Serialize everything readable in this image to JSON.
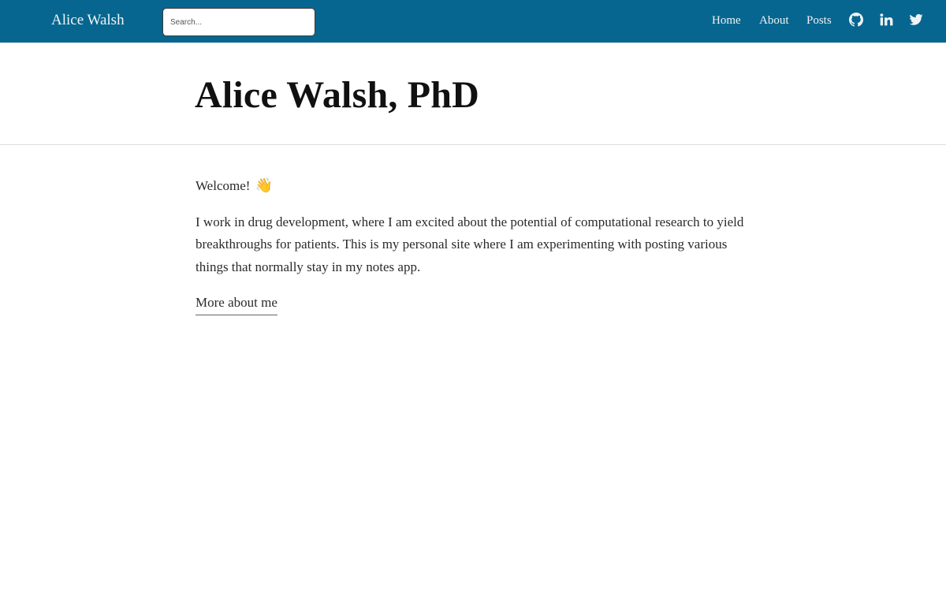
{
  "navbar": {
    "brand": "Alice Walsh",
    "search_placeholder": "Search...",
    "links": [
      "Home",
      "About",
      "Posts"
    ],
    "icons": [
      "github-icon",
      "linkedin-icon",
      "twitter-icon"
    ],
    "background_color": "#07668f"
  },
  "header": {
    "title": "Alice Walsh, PhD"
  },
  "main": {
    "welcome": "Welcome!",
    "welcome_emoji": "👋",
    "intro": "I work in drug development, where I am excited about the potential of computational research to yield breakthroughs for patients. This is my personal site where I am experimenting with posting various things that normally stay in my notes app.",
    "more_link": "More about me"
  }
}
